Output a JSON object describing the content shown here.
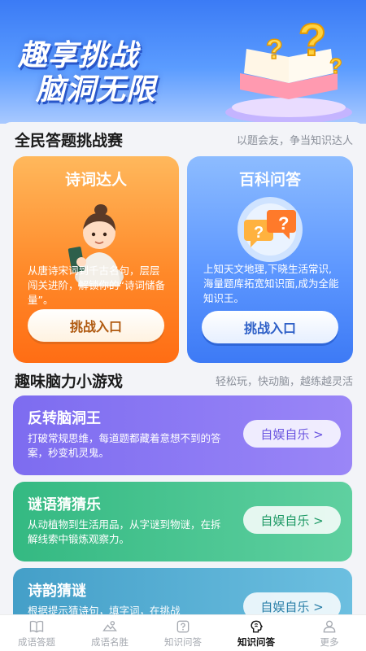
{
  "banner": {
    "title_line1": "趣享挑战",
    "title_line2": "脑洞无限"
  },
  "challenge": {
    "title": "全民答题挑战赛",
    "subtitle": "以题会友，争当知识达人",
    "cards": [
      {
        "title": "诗词达人",
        "desc": "从唐诗宋词到千古名句，层层闯关进阶，解锁你的“诗词储备量”。",
        "button": "挑战入口"
      },
      {
        "title": "百科问答",
        "desc": "上知天文地理,下晓生活常识,海量题库拓宽知识面,成为全能知识王。",
        "button": "挑战入口"
      }
    ]
  },
  "games": {
    "title": "趣味脑力小游戏",
    "subtitle": "轻松玩，快动脑，越练越灵活",
    "items": [
      {
        "title": "反转脑洞王",
        "desc": "打破常规思维，每道题都藏着意想不到的答案，秒变机灵鬼。",
        "button": "自娱自乐 >"
      },
      {
        "title": "谜语猜猜乐",
        "desc": "从动植物到生活用品，从字谜到物谜，在拆解线索中锻炼观察力。",
        "button": "自娱自乐 >"
      },
      {
        "title": "诗韵猜谜",
        "desc": "根据提示猜诗句，填字词，在挑战",
        "button": "自娱自乐 >"
      }
    ]
  },
  "tabs": [
    {
      "label": "成语答题",
      "icon": "book-icon"
    },
    {
      "label": "成语名胜",
      "icon": "landscape-icon"
    },
    {
      "label": "知识问答",
      "icon": "question-icon"
    },
    {
      "label": "知识问答",
      "icon": "brain-icon",
      "active": true
    },
    {
      "label": "更多",
      "icon": "user-icon"
    }
  ],
  "colors": {
    "orange": "#ff8a2a",
    "blue": "#5d97ff",
    "purple": "#7f6df2",
    "green": "#3cc08a",
    "teal": "#4aa3c9"
  }
}
